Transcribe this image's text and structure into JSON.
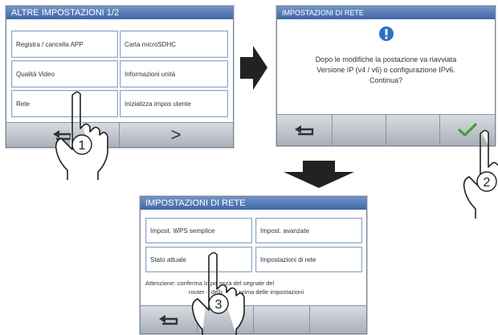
{
  "screen1": {
    "title": "ALTRE IMPOSTAZIONI 1/2",
    "buttons": [
      "Registra / cancella APP",
      "Carta microSDHC",
      "Qualità Video",
      "Informazioni unità",
      "Rete",
      "Inizializza impos utente"
    ],
    "nav": {
      "back_icon": "back-arrow-icon",
      "next_symbol": ">"
    }
  },
  "screen2": {
    "title": "IMPOSTAZIONI DI RETE",
    "alert_icon": "exclamation-icon",
    "message": [
      "Dopo le modifiche la postazione va riavviata",
      "Versione IP (v4 / v6) o configurazione IPv6.",
      "Continua?"
    ],
    "nav": {
      "back_icon": "back-arrow-icon",
      "confirm_icon": "check-icon"
    }
  },
  "screen3": {
    "title": "IMPOSTAZIONI DI RETE",
    "buttons": [
      "Impost. WPS semplice",
      "Impost. avanzate",
      "Stato attuale",
      "Impostazioni di rete"
    ],
    "warning": [
      "Attenzione: conferma la potenza del segnale del",
      "router e della BTB prima delle impostazioni"
    ],
    "nav": {
      "back_icon": "back-arrow-icon"
    }
  },
  "steps": [
    "1",
    "2",
    "3"
  ],
  "colors": {
    "titlebar": "#4a72b0",
    "button_border": "#8fa5c3",
    "check": "#3aa63a",
    "alert": "#2f6fc4",
    "arrow": "#222222"
  }
}
